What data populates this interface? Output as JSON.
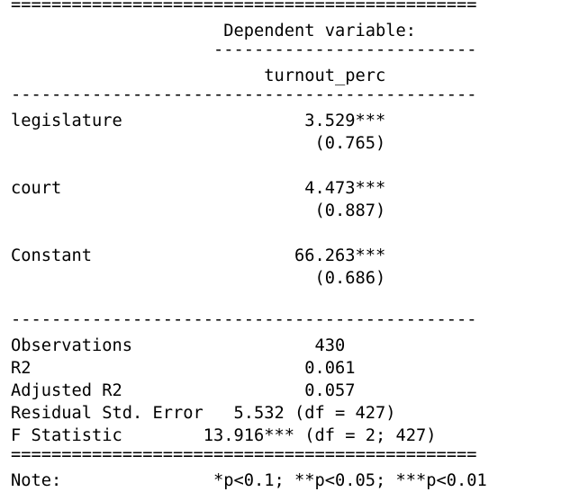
{
  "table": {
    "rule_double": "==============================================",
    "rule_single_full": "----------------------------------------------",
    "rule_single_partial": "                    --------------------------",
    "header_dep_var": "                     Dependent variable:",
    "header_dep_name": "                         turnout_perc",
    "coef_rows": [
      {
        "label": "legislature                  3.529***",
        "se": "                              (0.765)"
      },
      {
        "label": "court                        4.473***",
        "se": "                              (0.887)"
      },
      {
        "label": "Constant                    66.263***",
        "se": "                              (0.686)"
      }
    ],
    "stats": [
      "Observations                  430",
      "R2                           0.061",
      "Adjusted R2                  0.057",
      "Residual Std. Error   5.532 (df = 427)",
      "F Statistic        13.916*** (df = 2; 427)"
    ],
    "note": "Note:               *p<0.1; **p<0.05; ***p<0.01"
  }
}
